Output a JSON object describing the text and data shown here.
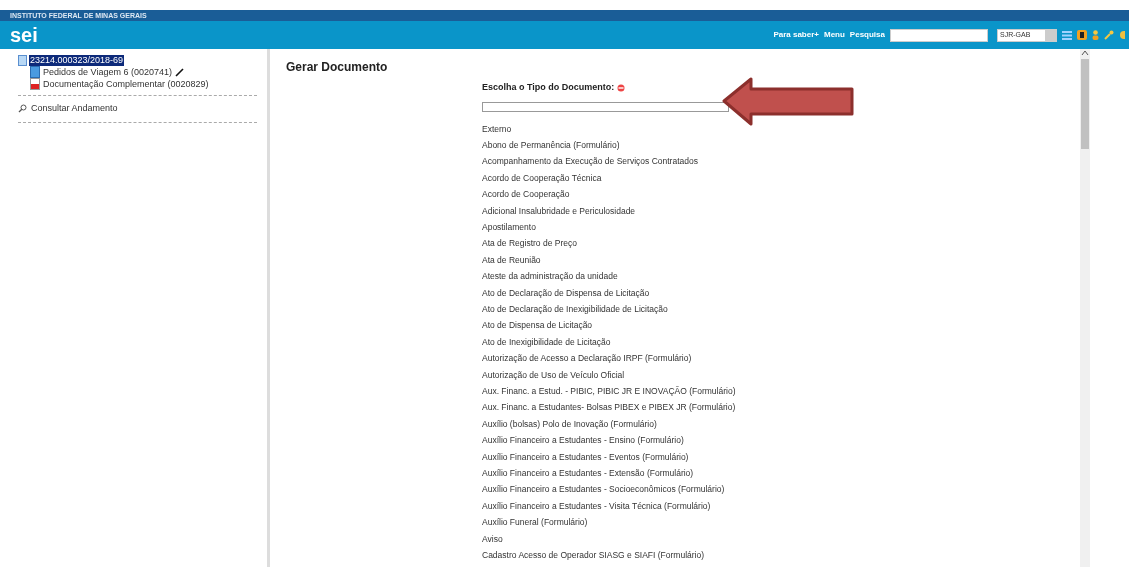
{
  "header": {
    "institution": "INSTITUTO FEDERAL DE MINAS GERAIS",
    "logo": "sei",
    "links": [
      "Para saber+",
      "Menu",
      "Pesquisa"
    ],
    "unit_select": {
      "value": "SJR-GAB"
    }
  },
  "tree": {
    "process": {
      "label": "23214.000323/2018-69",
      "selected": true
    },
    "children": [
      {
        "kind": "document",
        "label": "Pedidos de Viagem 6 (0020741)",
        "signable": true
      },
      {
        "kind": "pdf",
        "label": "Documentação Complementar (0020829)",
        "signable": false
      }
    ]
  },
  "sidebar_links": [
    "Consultar Andamento"
  ],
  "main": {
    "title": "Gerar Documento",
    "prompt": "Escolha o Tipo do Documento:",
    "types": [
      "Externo",
      "Abono de Permanência (Formulário)",
      "Acompanhamento da Execução de Serviços Contratados",
      "Acordo de Cooperação Técnica",
      "Acordo de Cooperação",
      "Adicional Insalubridade e Periculosidade",
      "Apostilamento",
      "Ata de Registro de Preço",
      "Ata de Reunião",
      "Ateste da administração da unidade",
      "Ato de Declaração de Dispensa de Licitação",
      "Ato de Declaração de Inexigibilidade de Licitação",
      "Ato de Dispensa de Licitação",
      "Ato de Inexigibilidade de Licitação",
      "Autorização de Acesso a Declaração IRPF (Formulário)",
      "Autorização de Uso de Veículo Oficial",
      "Aux. Financ. a Estud. - PIBIC, PIBIC JR E INOVAÇÃO (Formulário)",
      "Aux. Financ. a Estudantes- Bolsas PIBEX e PIBEX JR (Formulário)",
      "Auxílio (bolsas) Polo de Inovação (Formulário)",
      "Auxílio Financeiro a Estudantes - Ensino (Formulário)",
      "Auxílio Financeiro a Estudantes - Eventos (Formulário)",
      "Auxílio Financeiro a Estudantes - Extensão (Formulário)",
      "Auxílio Financeiro a Estudantes - Socioeconômicos (Formulário)",
      "Auxílio Financeiro a Estudantes - Visita Técnica (Formulário)",
      "Auxílio Funeral (Formulário)",
      "Aviso",
      "Cadastro Acesso de Operador SIASG e SIAFI (Formulário)"
    ]
  }
}
